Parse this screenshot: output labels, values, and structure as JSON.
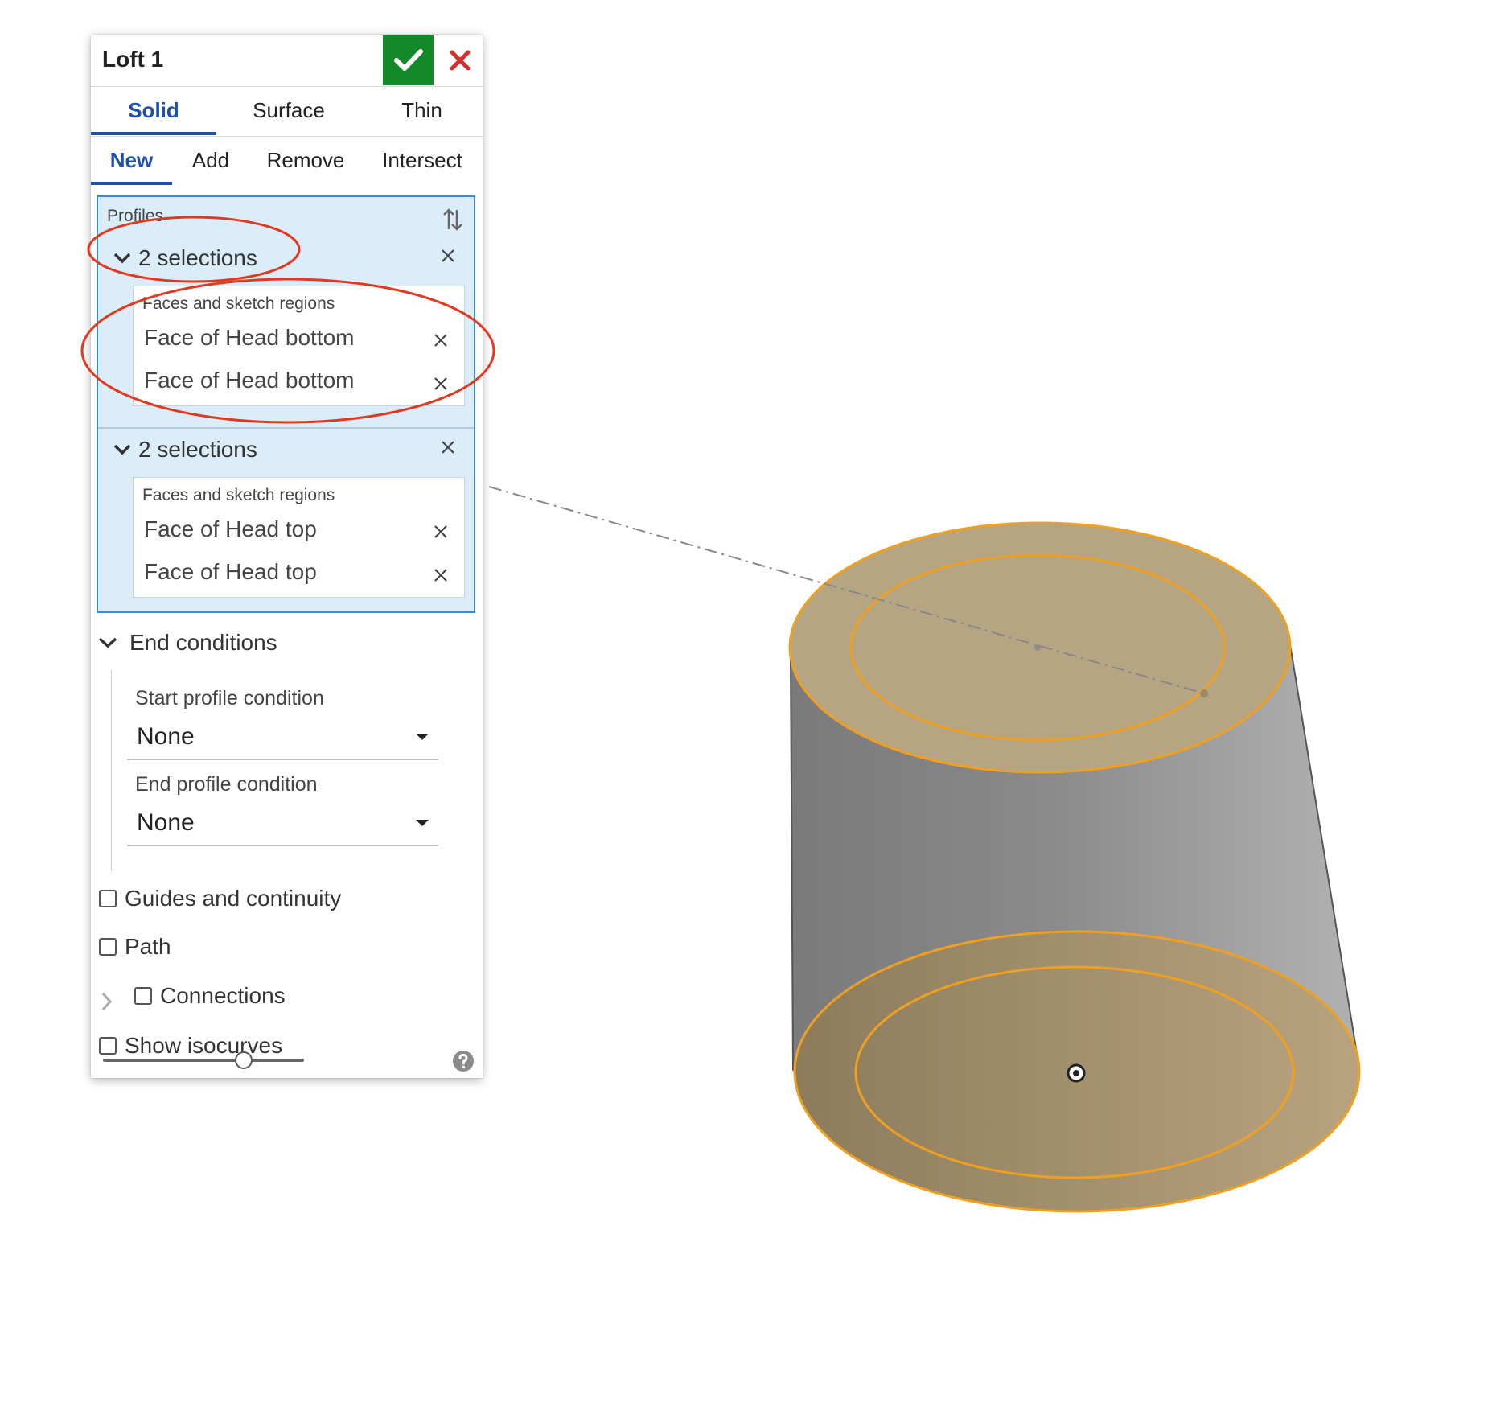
{
  "dialog": {
    "title": "Loft 1",
    "ok_icon": "check-icon",
    "cancel_icon": "close-icon",
    "type_tabs": [
      {
        "label": "Solid",
        "active": true
      },
      {
        "label": "Surface",
        "active": false
      },
      {
        "label": "Thin",
        "active": false
      }
    ],
    "op_tabs": [
      {
        "label": "New",
        "active": true
      },
      {
        "label": "Add",
        "active": false
      },
      {
        "label": "Remove",
        "active": false
      },
      {
        "label": "Intersect",
        "active": false
      }
    ],
    "profiles": {
      "label": "Profiles",
      "groups": [
        {
          "header": "2 selections",
          "list_caption": "Faces and sketch regions",
          "items": [
            "Face of Head bottom",
            "Face of Head bottom"
          ]
        },
        {
          "header": "2 selections",
          "list_caption": "Faces and sketch regions",
          "items": [
            "Face of Head top",
            "Face of Head top"
          ]
        }
      ]
    },
    "end_conditions": {
      "label": "End conditions",
      "start_label": "Start profile condition",
      "start_value": "None",
      "end_label": "End profile condition",
      "end_value": "None"
    },
    "checkboxes": {
      "guides": "Guides and continuity",
      "path": "Path",
      "connections": "Connections",
      "isocurves": "Show isocurves"
    },
    "slider_value": 0.7
  },
  "colors": {
    "accent_blue": "#1c4fae",
    "ok_green": "#13892a",
    "cancel_red": "#d32f2f",
    "selection_bg": "#dbedf8",
    "face_highlight": "#f0a020",
    "annotation_red": "#e2381f"
  }
}
